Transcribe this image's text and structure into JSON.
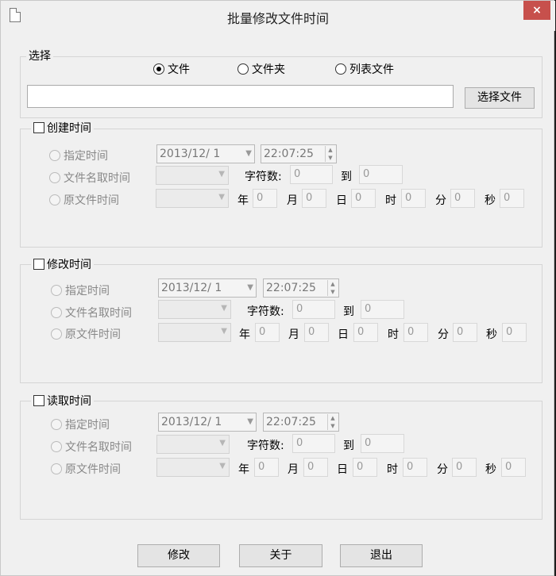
{
  "window": {
    "title": "批量修改文件时间",
    "close_glyph": "×"
  },
  "select_group": {
    "legend": "选择",
    "radios": [
      {
        "label": "文件",
        "checked": true
      },
      {
        "label": "文件夹",
        "checked": false
      },
      {
        "label": "列表文件",
        "checked": false
      }
    ],
    "path_value": "",
    "choose_button": "选择文件"
  },
  "labels": {
    "specify_time": "指定时间",
    "from_filename": "文件名取时间",
    "original_time": "原文件时间",
    "char_count": "字符数:",
    "to": "到",
    "year": "年",
    "month": "月",
    "day": "日",
    "hour": "时",
    "minute": "分",
    "second": "秒"
  },
  "sections": [
    {
      "legend": "创建时间",
      "date": "2013/12/  1",
      "time": "22:07:25",
      "char_from": "0",
      "char_to": "0",
      "ymd": [
        "0",
        "0",
        "0",
        "0",
        "0",
        "0"
      ]
    },
    {
      "legend": "修改时间",
      "date": "2013/12/  1",
      "time": "22:07:25",
      "char_from": "0",
      "char_to": "0",
      "ymd": [
        "0",
        "0",
        "0",
        "0",
        "0",
        "0"
      ]
    },
    {
      "legend": "读取时间",
      "date": "2013/12/  1",
      "time": "22:07:25",
      "char_from": "0",
      "char_to": "0",
      "ymd": [
        "0",
        "0",
        "0",
        "0",
        "0",
        "0"
      ]
    }
  ],
  "buttons": {
    "modify": "修改",
    "about": "关于",
    "exit": "退出"
  }
}
